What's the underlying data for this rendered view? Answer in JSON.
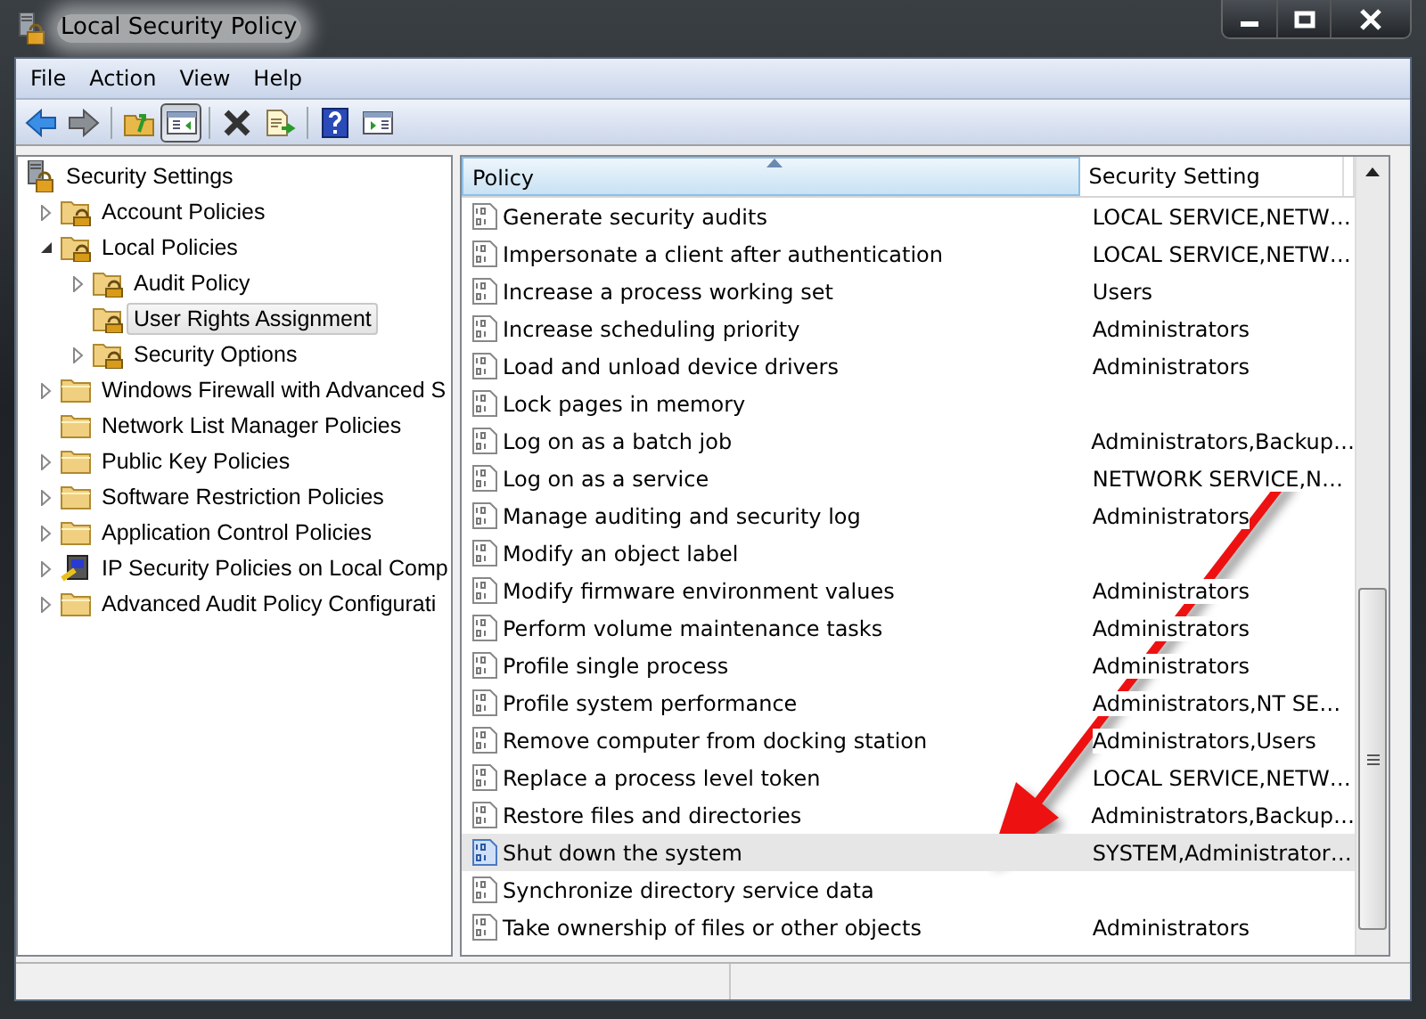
{
  "window": {
    "title": "Local Security Policy"
  },
  "menu": [
    "File",
    "Action",
    "View",
    "Help"
  ],
  "toolbar": [
    {
      "kind": "back",
      "pressed": false
    },
    {
      "kind": "forward",
      "pressed": false
    },
    {
      "kind": "separator"
    },
    {
      "kind": "up",
      "pressed": false
    },
    {
      "kind": "tree",
      "pressed": true
    },
    {
      "kind": "separator"
    },
    {
      "kind": "delete",
      "pressed": false
    },
    {
      "kind": "export",
      "pressed": false
    },
    {
      "kind": "separator"
    },
    {
      "kind": "help",
      "pressed": false
    },
    {
      "kind": "pane",
      "pressed": false
    }
  ],
  "tree": [
    {
      "label": "Security Settings",
      "kind": "root",
      "selected": false,
      "children": [
        {
          "label": "Account Policies",
          "kind": "lock-folder",
          "expanded": false,
          "selected": false
        },
        {
          "label": "Local Policies",
          "kind": "lock-folder",
          "expanded": true,
          "selected": false,
          "children": [
            {
              "label": "Audit Policy",
              "kind": "lock-folder",
              "expanded": false,
              "selected": false
            },
            {
              "label": "User Rights Assignment",
              "kind": "lock-folder",
              "selected": true
            },
            {
              "label": "Security Options",
              "kind": "lock-folder",
              "expanded": false,
              "selected": false
            }
          ]
        },
        {
          "label": "Windows Firewall with Advanced S",
          "kind": "folder",
          "expanded": false,
          "selected": false
        },
        {
          "label": "Network List Manager Policies",
          "kind": "folder",
          "selected": false
        },
        {
          "label": "Public Key Policies",
          "kind": "folder",
          "expanded": false,
          "selected": false
        },
        {
          "label": "Software Restriction Policies",
          "kind": "folder",
          "expanded": false,
          "selected": false
        },
        {
          "label": "Application Control Policies",
          "kind": "folder",
          "expanded": false,
          "selected": false
        },
        {
          "label": "IP Security Policies on Local Comp",
          "kind": "ip",
          "expanded": false,
          "selected": false
        },
        {
          "label": "Advanced Audit Policy Configurati",
          "kind": "folder",
          "expanded": false,
          "selected": false
        }
      ]
    }
  ],
  "table": {
    "columns": [
      "Policy",
      "Security Setting"
    ],
    "rows": [
      {
        "policy": "Generate security audits",
        "setting": "LOCAL SERVICE,NETW…",
        "selected": false
      },
      {
        "policy": "Impersonate a client after authentication",
        "setting": "LOCAL SERVICE,NETW…",
        "selected": false
      },
      {
        "policy": "Increase a process working set",
        "setting": "Users",
        "selected": false
      },
      {
        "policy": "Increase scheduling priority",
        "setting": "Administrators",
        "selected": false
      },
      {
        "policy": "Load and unload device drivers",
        "setting": "Administrators",
        "selected": false
      },
      {
        "policy": "Lock pages in memory",
        "selected": false
      },
      {
        "policy": "Log on as a batch job",
        "setting": "Administrators,Backup…",
        "selected": false
      },
      {
        "policy": "Log on as a service",
        "setting": "NETWORK SERVICE,N…",
        "selected": false
      },
      {
        "policy": "Manage auditing and security log",
        "setting": "Administrators",
        "selected": false
      },
      {
        "policy": "Modify an object label",
        "selected": false
      },
      {
        "policy": "Modify firmware environment values",
        "setting": "Administrators",
        "selected": false
      },
      {
        "policy": "Perform volume maintenance tasks",
        "setting": "Administrators",
        "selected": false
      },
      {
        "policy": "Profile single process",
        "setting": "Administrators",
        "selected": false
      },
      {
        "policy": "Profile system performance",
        "setting": "Administrators,NT SE…",
        "selected": false
      },
      {
        "policy": "Remove computer from docking station",
        "setting": "Administrators,Users",
        "selected": false
      },
      {
        "policy": "Replace a process level token",
        "setting": "LOCAL SERVICE,NETW…",
        "selected": false
      },
      {
        "policy": "Restore files and directories",
        "setting": "Administrators,Backup…",
        "selected": false
      },
      {
        "policy": "Shut down the system",
        "setting": "SYSTEM,Administrator…",
        "selected": true
      },
      {
        "policy": "Synchronize directory service data",
        "selected": false
      },
      {
        "policy": "Take ownership of files or other objects",
        "setting": "Administrators",
        "selected": false
      }
    ]
  }
}
